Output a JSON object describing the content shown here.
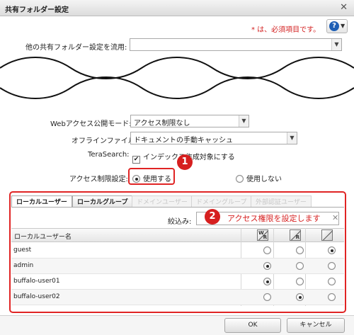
{
  "window": {
    "title": "共有フォルダー設定",
    "close_glyph": "✕"
  },
  "header": {
    "required_note": "* は、必須項目です。",
    "help_icon": "question-icon"
  },
  "form": {
    "copy_settings_label": "他の共有フォルダー設定を流用:",
    "copy_settings_value": "",
    "web_access_label": "Webアクセス公開モード:",
    "web_access_value": "アクセス制限なし",
    "offline_label": "オフラインファイル:",
    "offline_value": "ドキュメントの手動キャッシュ",
    "terasearch_label": "TeraSearch:",
    "terasearch_checkbox_label": "インデックス作成対象にする",
    "terasearch_checked": true,
    "access_restriction_label": "アクセス制限設定:",
    "access_restriction_options": [
      "使用する",
      "使用しない"
    ],
    "access_restriction_selected": 0
  },
  "annotations": {
    "badge1": "1",
    "badge2": "2",
    "note2": "アクセス権限を設定します"
  },
  "tabs": [
    {
      "label": "ローカルユーザー",
      "state": "active"
    },
    {
      "label": "ローカルグループ",
      "state": "normal"
    },
    {
      "label": "ドメインユーザー",
      "state": "disabled"
    },
    {
      "label": "ドメイングループ",
      "state": "disabled"
    },
    {
      "label": "外部認証ユーザー",
      "state": "disabled"
    }
  ],
  "filter": {
    "label": "絞込み:",
    "value": ""
  },
  "grid": {
    "column_name": "ローカルユーザー名",
    "perm_columns": [
      {
        "name": "read-write",
        "l1": "W",
        "l2": "R"
      },
      {
        "name": "read-only",
        "l1": "",
        "l2": "R"
      },
      {
        "name": "no-access",
        "l1": "",
        "l2": ""
      }
    ],
    "rows": [
      {
        "name": "guest",
        "selected": 2
      },
      {
        "name": "admin",
        "selected": 0
      },
      {
        "name": "buffalo-user01",
        "selected": 0
      },
      {
        "name": "buffalo-user02",
        "selected": 1
      }
    ]
  },
  "buttons": {
    "ok": "OK",
    "cancel": "キャンセル"
  },
  "colors": {
    "accent_red": "#e02424",
    "help_blue": "#1f5fb5"
  }
}
